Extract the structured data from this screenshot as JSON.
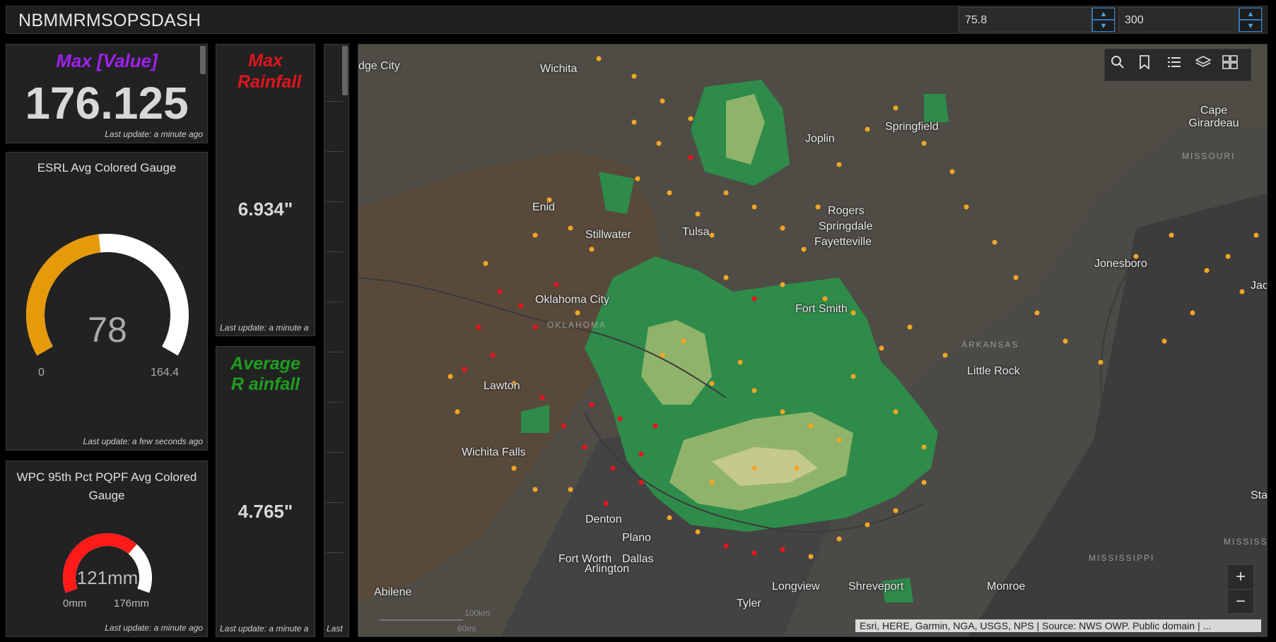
{
  "header": {
    "title": "NBMMRMSOPSDASH",
    "input1_value": "75.8",
    "input2_value": "300"
  },
  "max_value_panel": {
    "title": "Max [Value]",
    "value": "176.125",
    "last_update": "Last update: a minute ago",
    "colors": {
      "title": "#a020f0"
    }
  },
  "esrl_gauge": {
    "title": "ESRL Avg Colored Gauge",
    "value": "78",
    "min": "0",
    "max": "164.4",
    "fill_fraction": 0.474,
    "last_update": "Last update: a few seconds ago",
    "colors": {
      "fill": "#e59a0a",
      "track": "#ffffff"
    }
  },
  "wpc_gauge": {
    "title": "WPC 95th Pct PQPF Avg Colored Gauge",
    "value": "121mm",
    "min": "0mm",
    "max": "176mm",
    "fill_fraction": 0.6875,
    "last_update": "Last update: a minute ago",
    "colors": {
      "fill": "#ff1a1a",
      "track": "#ffffff"
    }
  },
  "max_rainfall": {
    "title": "Max Rainfall",
    "value": "6.934\"",
    "last_update": "Last update: a minute a",
    "colors": {
      "title": "#e0141e"
    }
  },
  "avg_rainfall": {
    "title": "Average R ainfall",
    "value": "4.765\"",
    "last_update": "Last update: a minute a",
    "colors": {
      "title": "#1e9e1e"
    }
  },
  "narrow_list": {
    "footer": "Last"
  },
  "map": {
    "cities": [
      {
        "name": "dge City"
      },
      {
        "name": "Wichita"
      },
      {
        "name": "Joplin"
      },
      {
        "name": "Springfield"
      },
      {
        "name": "Cape Girardeau"
      },
      {
        "name": "Enid"
      },
      {
        "name": "Stillwater"
      },
      {
        "name": "Tulsa"
      },
      {
        "name": "Rogers"
      },
      {
        "name": "Springdale"
      },
      {
        "name": "Fayetteville"
      },
      {
        "name": "Jonesboro"
      },
      {
        "name": "Jack"
      },
      {
        "name": "Oklahoma City"
      },
      {
        "name": "Fort Smith"
      },
      {
        "name": "Lawton"
      },
      {
        "name": "Little Rock"
      },
      {
        "name": "Wichita Falls"
      },
      {
        "name": "Denton"
      },
      {
        "name": "Plano"
      },
      {
        "name": "Fort Worth"
      },
      {
        "name": "Dallas"
      },
      {
        "name": "Arlington"
      },
      {
        "name": "Abilene"
      },
      {
        "name": "Longview"
      },
      {
        "name": "Shreveport"
      },
      {
        "name": "Monroe"
      },
      {
        "name": "Tyler"
      },
      {
        "name": "Stark"
      }
    ],
    "states": [
      {
        "name": "MISSOURI"
      },
      {
        "name": "OKLAHOMA"
      },
      {
        "name": "ARKANSAS"
      },
      {
        "name": "MISSISSIPPI"
      },
      {
        "name": "MISSISSI"
      }
    ],
    "scale": {
      "km": "100km",
      "mi": "60mi"
    },
    "attribution": "Esri, HERE, Garmin, NGA, USGS, NPS | Source: NWS OWP. Public domain | ...",
    "tools": [
      "search-icon",
      "bookmark-icon",
      "legend-icon",
      "layers-icon",
      "basemap-gallery-icon"
    ],
    "zoom_in": "+",
    "zoom_out": "−",
    "colors": {
      "rain_green": "#2e8b4a",
      "rain_light": "#8fb36a",
      "rain_pale": "#c6c98e",
      "drought_brown": "#5a4a3a",
      "dot_orange": "#f5a623",
      "dot_red": "#e8141e"
    }
  }
}
